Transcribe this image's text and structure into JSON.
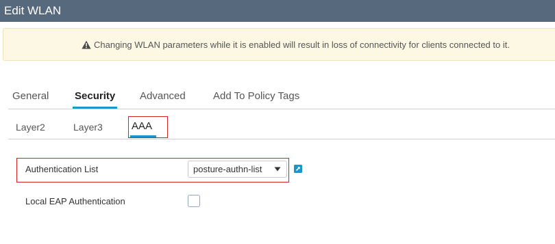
{
  "header": {
    "title": "Edit WLAN"
  },
  "warning": {
    "icon": "warning-triangle-icon",
    "text": "Changing WLAN parameters while it is enabled will result in loss of connectivity for clients connected to it."
  },
  "tabs": [
    {
      "label": "General",
      "active": false
    },
    {
      "label": "Security",
      "active": true
    },
    {
      "label": "Advanced",
      "active": false
    },
    {
      "label": "Add To Policy Tags",
      "active": false
    }
  ],
  "subtabs": [
    {
      "label": "Layer2",
      "active": false
    },
    {
      "label": "Layer3",
      "active": false
    },
    {
      "label": "AAA",
      "active": true
    }
  ],
  "form": {
    "authentication_list": {
      "label": "Authentication List",
      "value": "posture-authn-list",
      "edit_icon": "external-link-icon"
    },
    "local_eap": {
      "label": "Local EAP Authentication",
      "checked": false
    }
  },
  "colors": {
    "header_bg": "#56697d",
    "accent": "#1a96c8",
    "highlight_box": "#d42020",
    "warning_bg": "#fcf8e3"
  }
}
